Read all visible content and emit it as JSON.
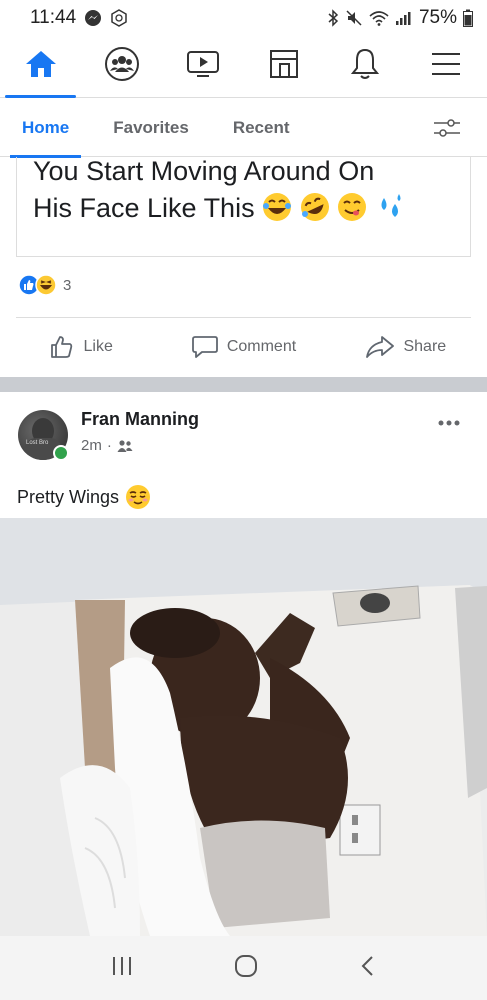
{
  "status_bar": {
    "time": "11:44",
    "battery": "75%",
    "icons": [
      "messenger-icon",
      "vpn-icon",
      "bluetooth-icon",
      "mute-icon",
      "wifi-icon",
      "signal-icon",
      "battery-icon"
    ]
  },
  "top_nav": {
    "items": [
      "home-icon",
      "groups-icon",
      "watch-icon",
      "marketplace-icon",
      "notifications-icon",
      "menu-icon"
    ],
    "accent": "#1877f2"
  },
  "sub_tabs": {
    "tabs": [
      "Home",
      "Favorites",
      "Recent"
    ],
    "active": "Home"
  },
  "prev_post": {
    "line1": "You Start  Moving Around On",
    "line2": "His Face Like This",
    "reaction_count": "3"
  },
  "actions": {
    "like": "Like",
    "comment": "Comment",
    "share": "Share"
  },
  "post": {
    "author": "Fran Manning",
    "time": "2m",
    "avatar_caption": "Lost Bro",
    "text": "Pretty Wings"
  }
}
